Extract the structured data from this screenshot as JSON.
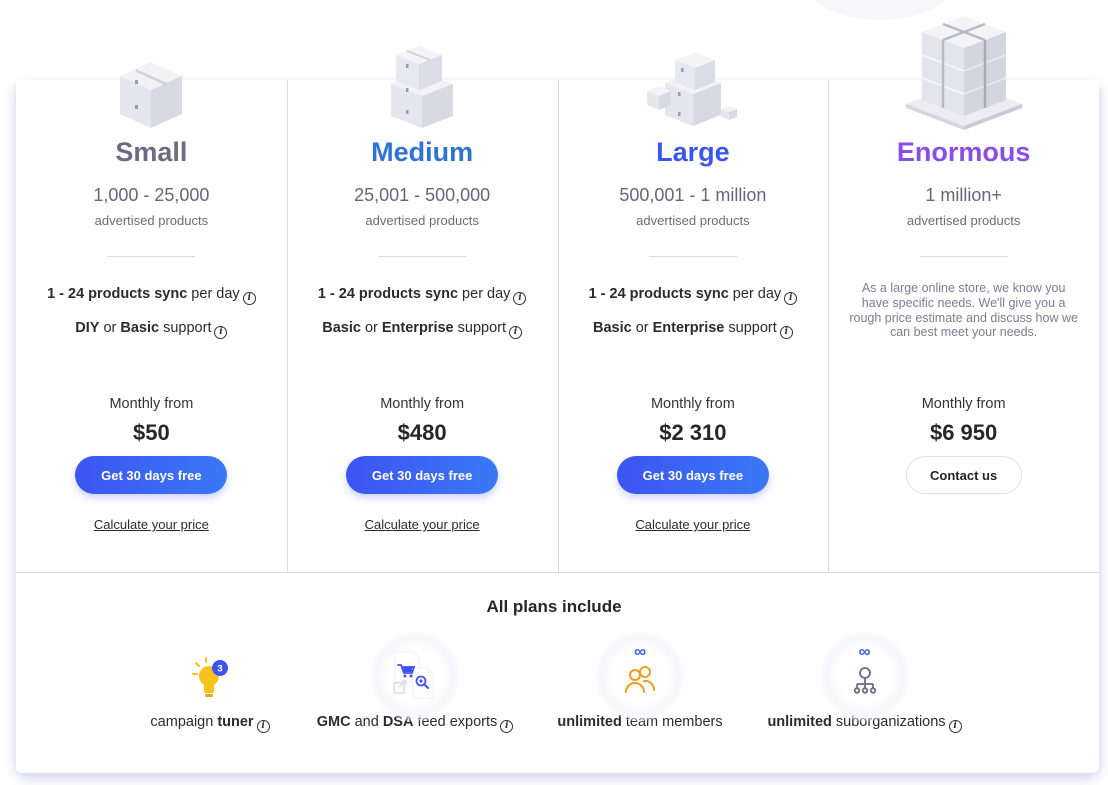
{
  "plans": [
    {
      "id": "small",
      "name": "Small",
      "name_color": "#6b6b85",
      "range": "1,000 - 25,000",
      "unit": "advertised products",
      "features": [
        {
          "parts": [
            {
              "t": "1 - 24 products sync",
              "b": true
            },
            {
              "t": " per day",
              "b": false
            }
          ],
          "info": true
        },
        {
          "parts": [
            {
              "t": "DIY",
              "b": true
            },
            {
              "t": " or ",
              "b": false
            },
            {
              "t": "Basic",
              "b": true
            },
            {
              "t": " support",
              "b": false
            }
          ],
          "info": true
        }
      ],
      "monthly_label": "Monthly from",
      "price": "$50",
      "cta_label": "Get 30 days free",
      "cta_style": "primary",
      "link_label": "Calculate your price"
    },
    {
      "id": "medium",
      "name": "Medium",
      "name_color": "#2f72d6",
      "range": "25,001 - 500,000",
      "unit": "advertised products",
      "features": [
        {
          "parts": [
            {
              "t": "1 - 24 products sync",
              "b": true
            },
            {
              "t": " per day",
              "b": false
            }
          ],
          "info": true
        },
        {
          "parts": [
            {
              "t": "Basic",
              "b": true
            },
            {
              "t": " or ",
              "b": false
            },
            {
              "t": "Enterprise",
              "b": true
            },
            {
              "t": " support",
              "b": false
            }
          ],
          "info": true
        }
      ],
      "monthly_label": "Monthly from",
      "price": "$480",
      "cta_label": "Get 30 days free",
      "cta_style": "primary",
      "link_label": "Calculate your price"
    },
    {
      "id": "large",
      "name": "Large",
      "name_color": "#3b55ee",
      "range": "500,001 - 1 million",
      "unit": "advertised products",
      "features": [
        {
          "parts": [
            {
              "t": "1 - 24 products sync",
              "b": true
            },
            {
              "t": " per day",
              "b": false
            }
          ],
          "info": true
        },
        {
          "parts": [
            {
              "t": "Basic",
              "b": true
            },
            {
              "t": " or ",
              "b": false
            },
            {
              "t": "Enterprise",
              "b": true
            },
            {
              "t": " support",
              "b": false
            }
          ],
          "info": true
        }
      ],
      "monthly_label": "Monthly from",
      "price": "$2 310",
      "cta_label": "Get 30 days free",
      "cta_style": "primary",
      "link_label": "Calculate your price"
    },
    {
      "id": "enormous",
      "name": "Enormous",
      "name_color": "#8a4de6",
      "range": "1 million+",
      "unit": "advertised products",
      "description": "As a large online store, we know you have specific needs. We'll give you a rough price estimate and discuss how we can best meet your needs.",
      "monthly_label": "Monthly from",
      "price": "$6 950",
      "cta_label": "Contact us",
      "cta_style": "outline"
    }
  ],
  "includes": {
    "title": "All plans include",
    "items": [
      {
        "icon": "lightbulb-icon",
        "badge": "3",
        "parts": [
          {
            "t": "campaign ",
            "b": false
          },
          {
            "t": "tuner",
            "b": true
          }
        ],
        "info": true
      },
      {
        "icon": "feed-export-icon",
        "parts": [
          {
            "t": "GMC",
            "b": true
          },
          {
            "t": " and ",
            "b": false
          },
          {
            "t": "DSA",
            "b": true
          },
          {
            "t": " feed exports",
            "b": false
          }
        ],
        "info": true
      },
      {
        "icon": "team-members-icon",
        "infinity": "∞",
        "parts": [
          {
            "t": "unlimited",
            "b": true
          },
          {
            "t": " team members",
            "b": false
          }
        ],
        "info": false
      },
      {
        "icon": "suborganizations-icon",
        "infinity": "∞",
        "parts": [
          {
            "t": "unlimited",
            "b": true
          },
          {
            "t": " suborganizations",
            "b": false
          }
        ],
        "info": true
      }
    ]
  },
  "colors": {
    "primary_button": "#3c55f2",
    "bulb": "#f7c21c",
    "team_icon": "#f29b1e",
    "infinity": "#4058f0"
  }
}
